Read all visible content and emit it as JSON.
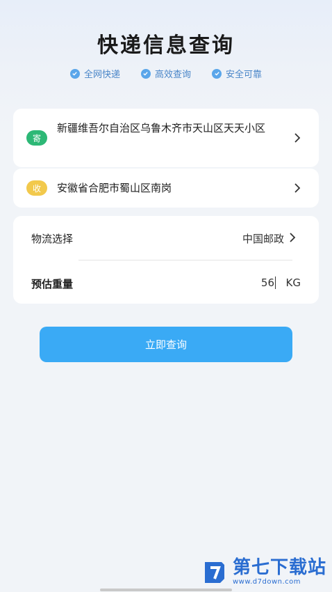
{
  "header": {
    "title": "快递信息查询",
    "features": [
      "全网快递",
      "高效查询",
      "安全可靠"
    ]
  },
  "sender": {
    "badge": "寄",
    "address": "新疆维吾尔自治区乌鲁木齐市天山区天天小区"
  },
  "receiver": {
    "badge": "收",
    "address": "安徽省合肥市蜀山区南岗"
  },
  "options": {
    "logistics_label": "物流选择",
    "logistics_value": "中国邮政",
    "weight_label": "预估重量",
    "weight_value": "56",
    "weight_unit": "KG"
  },
  "actions": {
    "submit_label": "立即查询"
  },
  "watermark": {
    "name": "第七下载站",
    "url": "www.d7down.com"
  },
  "colors": {
    "accent": "#3aaaf5",
    "send_badge": "#2db876",
    "recv_badge": "#f2c94c"
  }
}
